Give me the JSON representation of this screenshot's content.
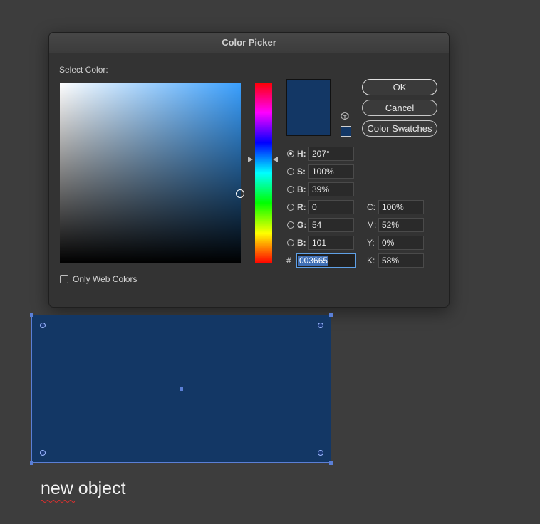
{
  "dialog": {
    "title": "Color Picker",
    "select_color_label": "Select Color:",
    "buttons": {
      "ok": "OK",
      "cancel": "Cancel",
      "swatches": "Color Swatches"
    },
    "only_web_colors_label": "Only Web Colors",
    "only_web_colors_checked": false,
    "current_color": "#133765",
    "hsb": {
      "h": {
        "label": "H:",
        "value": "207°",
        "selected": true
      },
      "s": {
        "label": "S:",
        "value": "100%"
      },
      "b": {
        "label": "B:",
        "value": "39%"
      }
    },
    "rgb": {
      "r": {
        "label": "R:",
        "value": "0"
      },
      "g": {
        "label": "G:",
        "value": "54"
      },
      "b": {
        "label": "B:",
        "value": "101"
      }
    },
    "cmyk": {
      "c": {
        "label": "C:",
        "value": "100%"
      },
      "m": {
        "label": "M:",
        "value": "52%"
      },
      "y": {
        "label": "Y:",
        "value": "0%"
      },
      "k": {
        "label": "K:",
        "value": "58%"
      }
    },
    "hex": {
      "label": "#",
      "value": "003665"
    }
  },
  "canvas": {
    "object_fill": "#133765",
    "selection_color": "#5b7fd6",
    "caption": "new object"
  }
}
